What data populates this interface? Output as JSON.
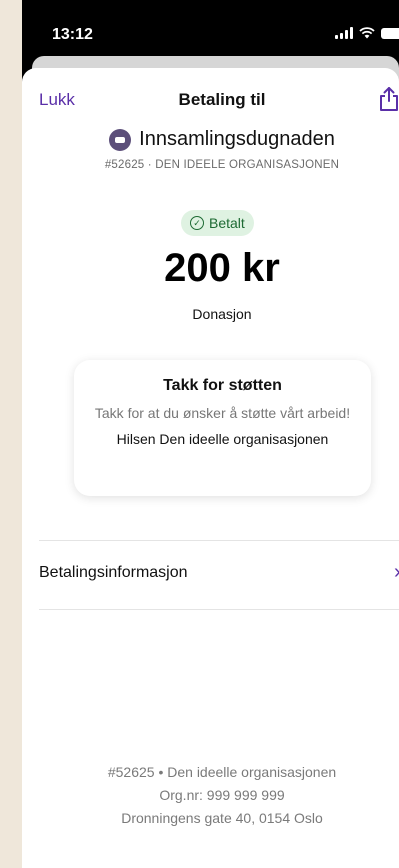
{
  "status_bar": {
    "time": "13:12"
  },
  "nav": {
    "close_label": "Lukk",
    "title": "Betaling til"
  },
  "organization": {
    "name": "Innsamlingsdugnaden",
    "subtitle": "#52625 · DEN IDEELE ORGANISASJONEN"
  },
  "payment": {
    "status_label": "Betalt",
    "amount": "200 kr",
    "type": "Donasjon"
  },
  "message_card": {
    "title": "Takk for støtten",
    "body": "Takk for at du ønsker å støtte vårt arbeid!",
    "signature": "Hilsen Den ideelle organisasjonen"
  },
  "info_row": {
    "label": "Betalingsinformasjon"
  },
  "footer": {
    "line1": "#52625 • Den ideelle organisasjonen",
    "line2": "Org.nr: 999 999 999",
    "line3": "Dronningens gate 40, 0154 Oslo"
  },
  "colors": {
    "accent": "#5a2fa8",
    "status_green": "#1d6a33",
    "status_bg": "#dff2e2",
    "page_bg": "#efe7da"
  },
  "icons": [
    "share-icon",
    "checkmark-circle-icon",
    "chevron-right-icon",
    "signal-icon",
    "wifi-icon",
    "battery-icon"
  ]
}
